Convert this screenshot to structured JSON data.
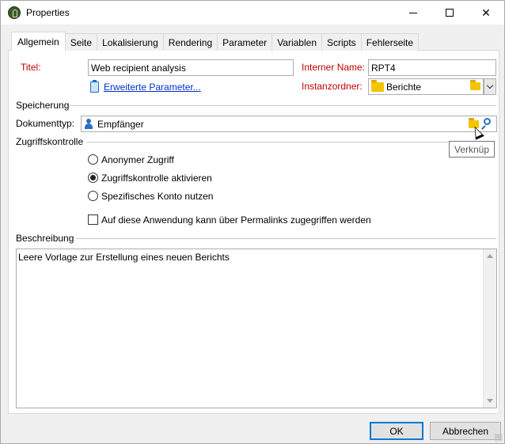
{
  "window": {
    "title": "Properties"
  },
  "tabs": [
    "Allgemein",
    "Seite",
    "Lokalisierung",
    "Rendering",
    "Parameter",
    "Variablen",
    "Scripts",
    "Fehlerseite"
  ],
  "general": {
    "title_label": "Titel:",
    "title_value": "Web recipient analysis",
    "internal_name_label": "Interner Name:",
    "internal_name_value": "RPT4",
    "advanced_params_link": "Erweiterte Parameter...",
    "instance_folder_label": "Instanzordner:",
    "instance_folder_value": "Berichte"
  },
  "storage": {
    "section_label": "Speicherung",
    "document_type_label": "Dokumenttyp:",
    "document_type_value": "Empfänger",
    "tooltip": "Verknüp"
  },
  "access": {
    "section_label": "Zugriffskontrolle",
    "options": [
      "Anonymer Zugriff",
      "Zugriffskontrolle aktivieren",
      "Spezifisches Konto nutzen"
    ],
    "selected_index": 1,
    "permalink_checkbox": "Auf diese Anwendung kann über Permalinks zugegriffen werden",
    "permalink_checked": false
  },
  "description": {
    "section_label": "Beschreibung",
    "text": "Leere Vorlage zur Erstellung eines neuen Berichts"
  },
  "buttons": {
    "ok": "OK",
    "cancel": "Abbrechen"
  },
  "colors": {
    "required_label": "#c00000",
    "link": "#0033cc",
    "accent": "#0078d7",
    "folder": "#f5c400"
  }
}
